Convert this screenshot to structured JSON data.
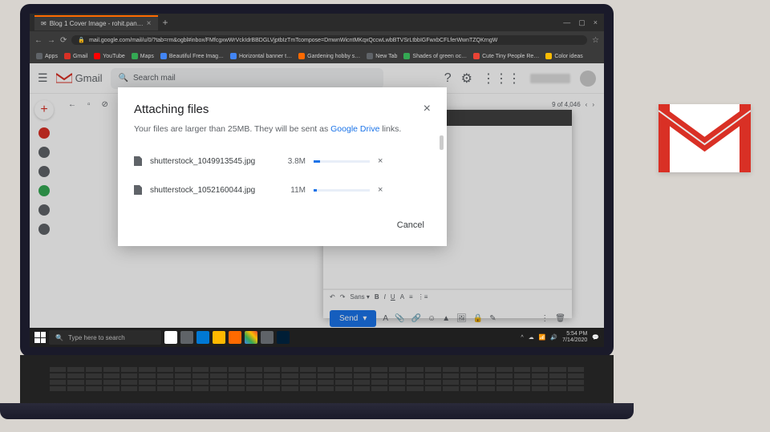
{
  "browser": {
    "tab_title": "Blog 1 Cover Image - rohit.pan…",
    "url": "mail.google.com/mail/u/0/?tab=rm&ogbl#inbox/FMfcgxwWrVckIdrBBDGLVjptbIzTmTcompose=DmwnWicntMKqxQccwLwbBTVSrLtbbIGFwxbCFLferWwnTZQKrngW",
    "bookmarks": [
      {
        "label": "Apps",
        "color": "#5f6368"
      },
      {
        "label": "Gmail",
        "color": "#d93025"
      },
      {
        "label": "YouTube",
        "color": "#ff0000"
      },
      {
        "label": "Maps",
        "color": "#34a853"
      },
      {
        "label": "Beautiful Free Imag…",
        "color": "#4285f4"
      },
      {
        "label": "Horizontal banner t…",
        "color": "#4285f4"
      },
      {
        "label": "Gardening hobby s…",
        "color": "#ff6a00"
      },
      {
        "label": "New Tab",
        "color": "#5f6368"
      },
      {
        "label": "Shades of green oc…",
        "color": "#34a853"
      },
      {
        "label": "Cute Tiny People Re…",
        "color": "#ea4335"
      },
      {
        "label": "Color ideas",
        "color": "#fbbc04"
      }
    ]
  },
  "gmail": {
    "brand": "Gmail",
    "search_placeholder": "Search mail",
    "counter": "9 of 4,046",
    "send_label": "Send"
  },
  "dialog": {
    "title": "Attaching files",
    "message_prefix": "Your files are larger than 25MB. They will be sent as ",
    "link_text": "Google Drive",
    "message_suffix": " links.",
    "cancel_label": "Cancel",
    "files": [
      {
        "name": "shutterstock_1049913545.jpg",
        "size": "3.8M",
        "progress": 12
      },
      {
        "name": "shutterstock_1052160044.jpg",
        "size": "11M",
        "progress": 5
      }
    ]
  },
  "taskbar": {
    "search_placeholder": "Type here to search",
    "time": "5:54 PM",
    "date": "7/14/2020"
  }
}
